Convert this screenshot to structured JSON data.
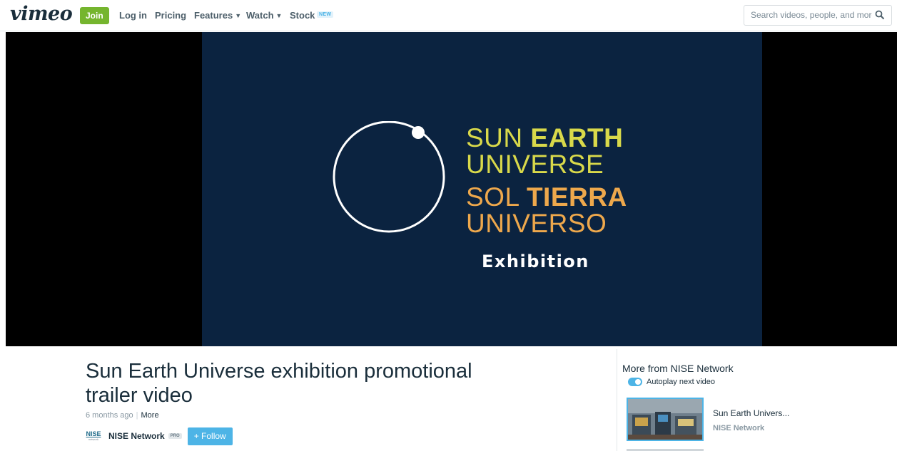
{
  "nav": {
    "logo": "vimeo",
    "join": "Join",
    "login": "Log in",
    "pricing": "Pricing",
    "features": "Features",
    "watch": "Watch",
    "stock": "Stock",
    "stock_badge": "NEW",
    "search_placeholder": "Search videos, people, and more"
  },
  "video_frame": {
    "line1_regular": "SUN ",
    "line1_bold": "EARTH",
    "line2": "UNIVERSE",
    "line3_regular": "SOL ",
    "line3_bold": "TIERRA",
    "line4": "UNIVERSO",
    "line5": "Exhibition",
    "colors": {
      "background": "#0b2340",
      "english": "#d9d94a",
      "spanish": "#eea84c"
    }
  },
  "video": {
    "title": "Sun Earth Universe exhibition promotional trailer video",
    "posted": "6 months ago",
    "more": "More",
    "owner_logo_text": "NISE",
    "owner_logo_sub": "network",
    "owner": "NISE Network",
    "owner_badge": "PRO",
    "follow": "+ Follow"
  },
  "sidebar": {
    "title": "More from NISE Network",
    "autoplay_label": "Autoplay next video",
    "autoplay_on": true,
    "items": [
      {
        "title": "Sun Earth Univers...",
        "owner": "NISE Network"
      }
    ]
  },
  "colors": {
    "brand": "#1a2e3b",
    "join": "#75b52e",
    "accent": "#4db4e6"
  }
}
